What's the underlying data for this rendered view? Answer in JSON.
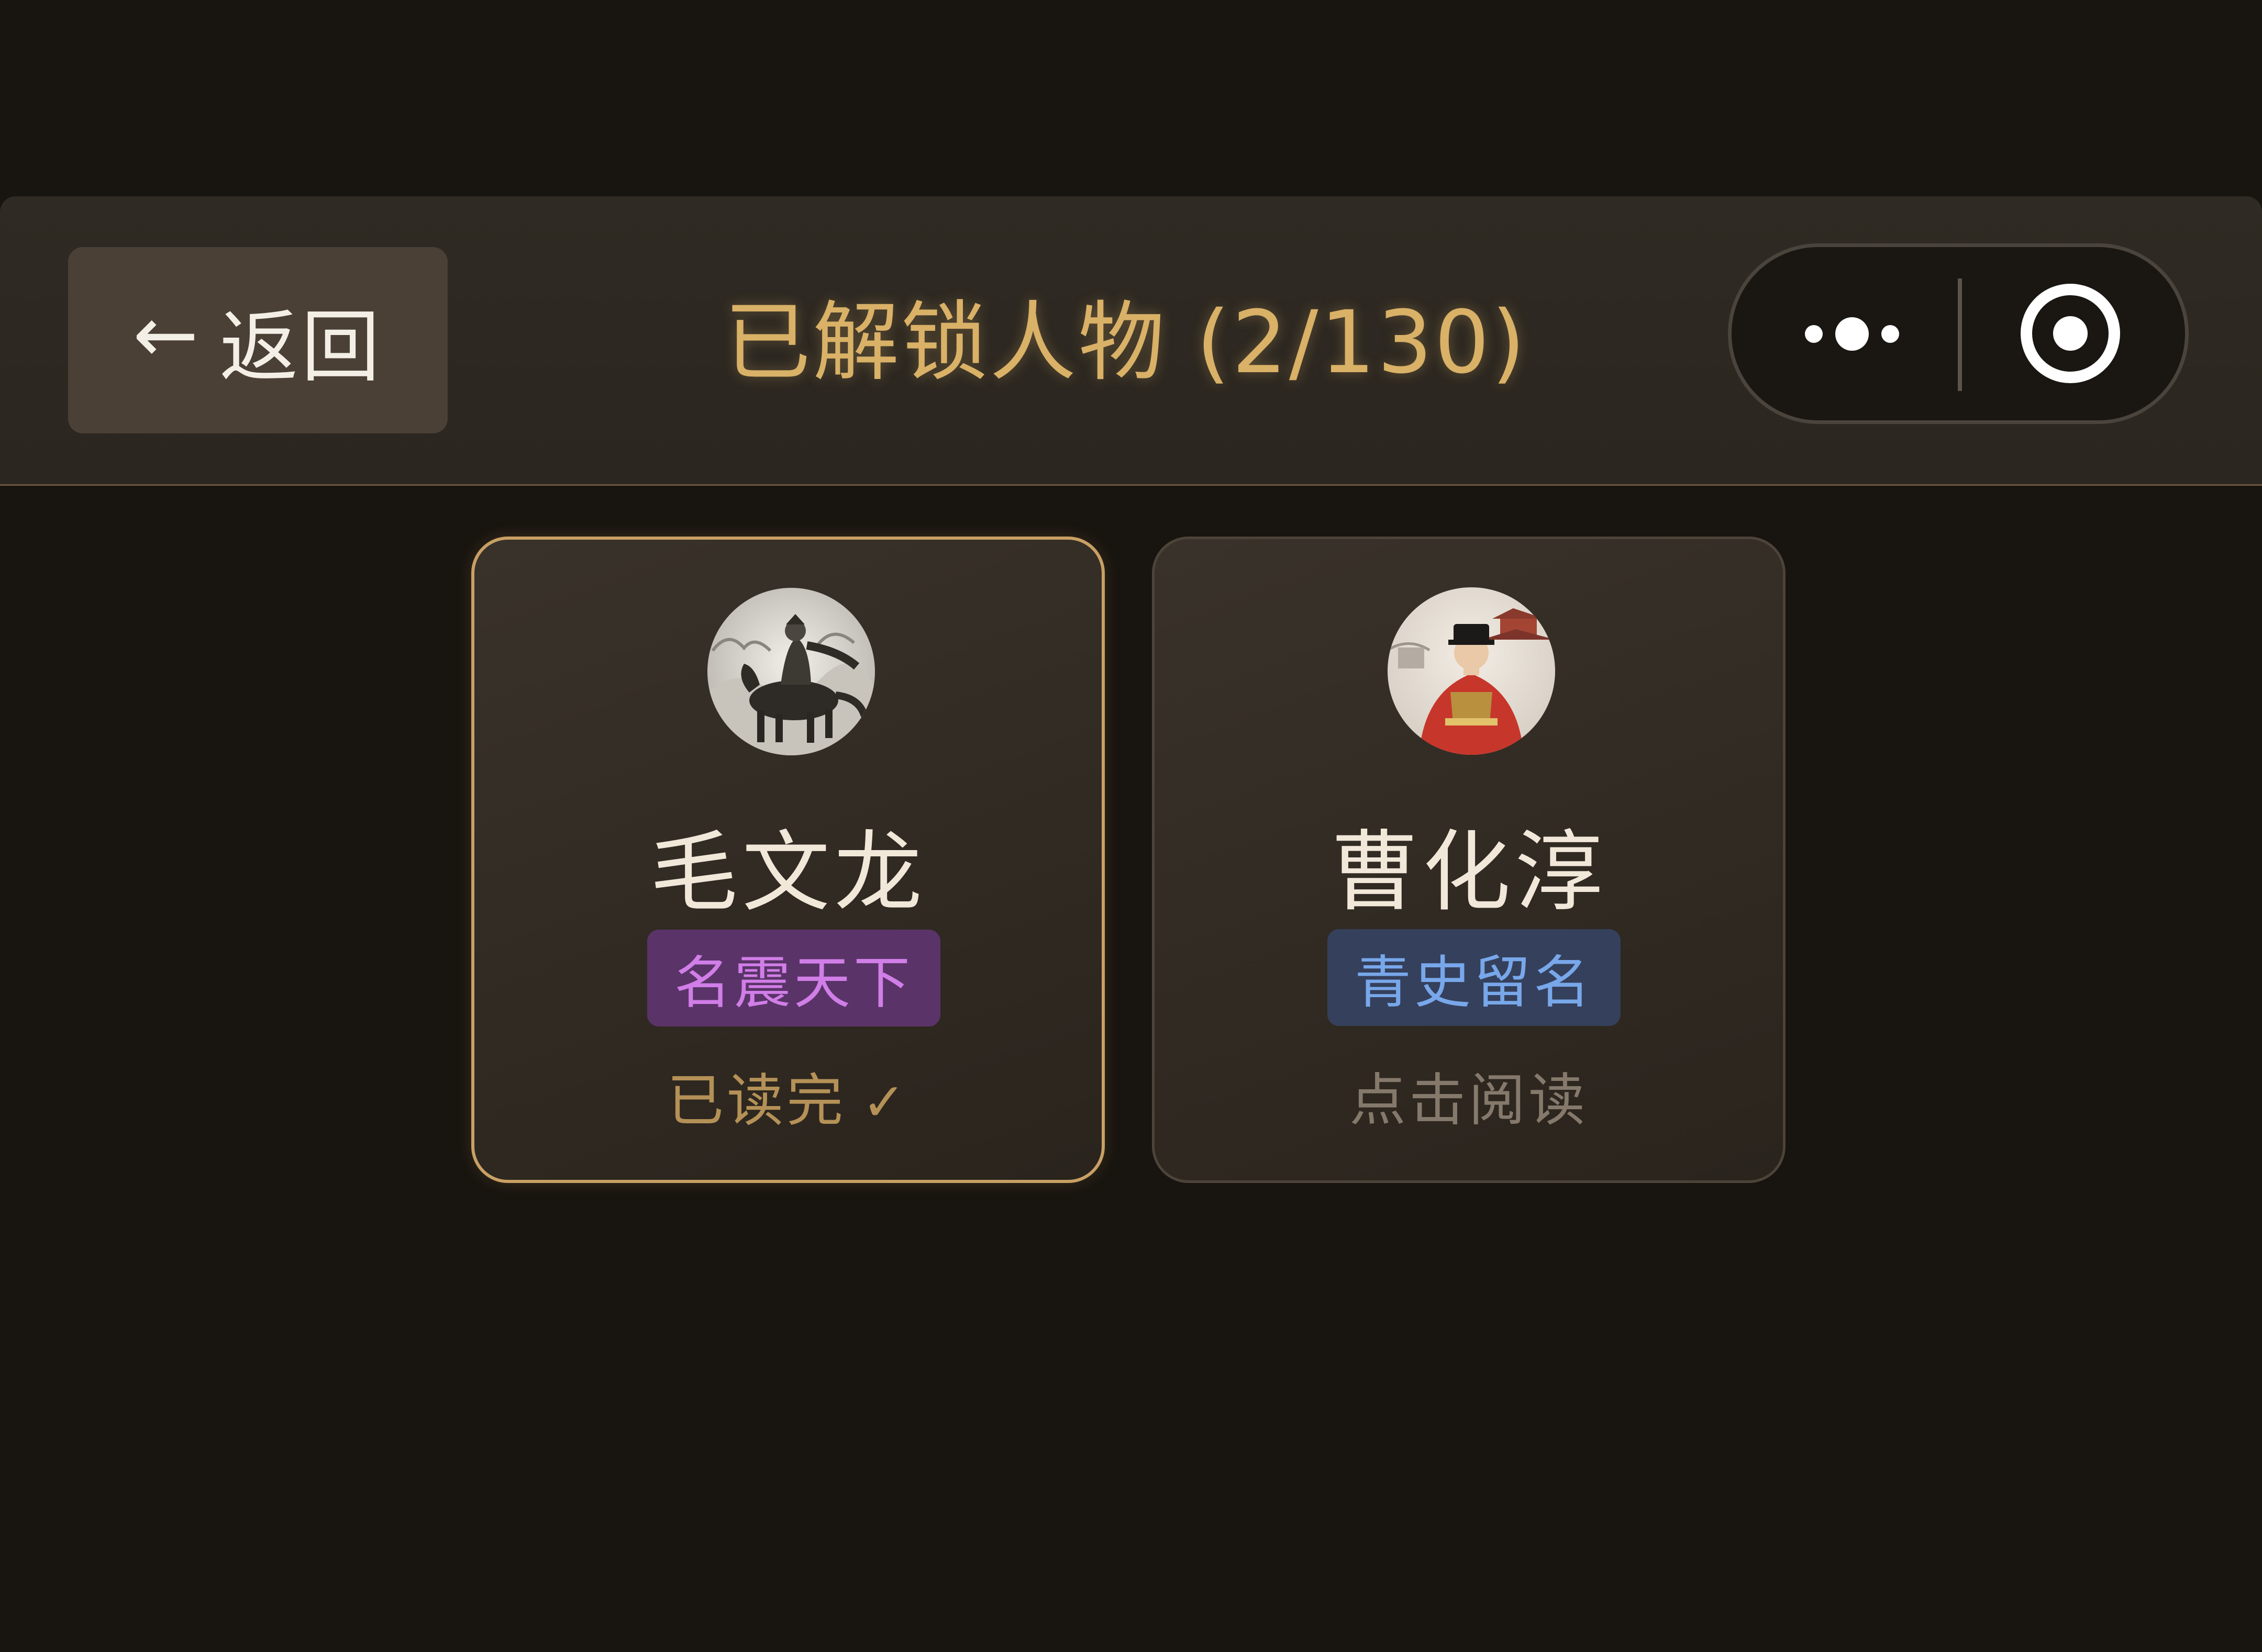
{
  "header": {
    "back_arrow": "←",
    "back_label": "返回",
    "title": "已解锁人物 (2/130)"
  },
  "capsule": {
    "more_icon": "more-dots-icon",
    "target_icon": "target-icon"
  },
  "characters": [
    {
      "name": "毛文龙",
      "badge": "名震天下",
      "badge_color": "#d17ee8",
      "status": "已读完",
      "status_icon": "✓",
      "selected": true
    },
    {
      "name": "曹化淳",
      "badge": "青史留名",
      "badge_color": "#78a7ea",
      "status": "点击阅读",
      "selected": false
    }
  ],
  "colors": {
    "accent": "#d9b167",
    "background": "#18140f",
    "selected_border": "#c9a064"
  }
}
